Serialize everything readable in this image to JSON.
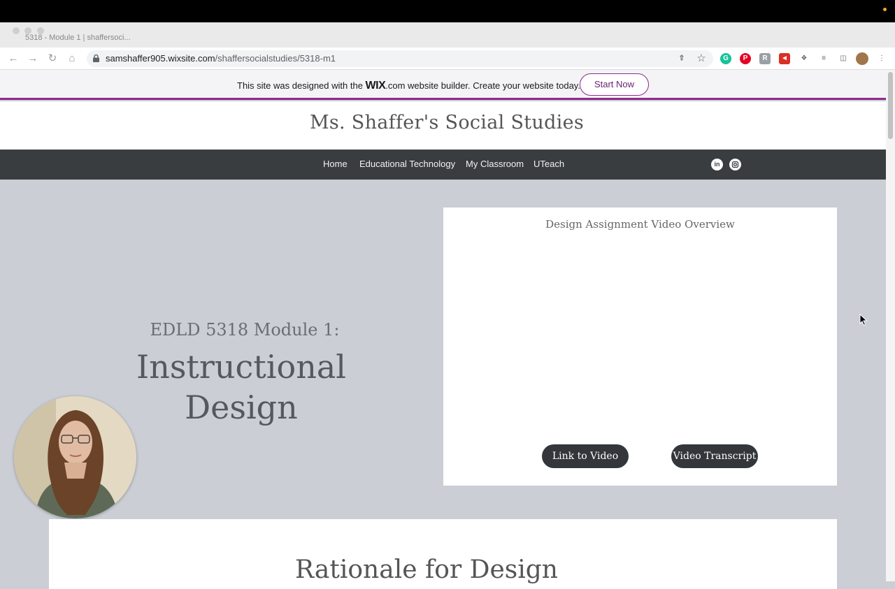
{
  "browser": {
    "tab_title": "5318 - Module 1 | shaffersoci...",
    "url_host": "samshaffer905.wixsite.com",
    "url_path": "/shaffersocialstudies/5318-m1"
  },
  "wix_banner": {
    "text_before": "This site was designed with the ",
    "brand": "WIX",
    "text_after": ".com website builder. Create your website today.",
    "cta_label": "Start Now"
  },
  "site": {
    "title": "Ms. Shaffer's Social Studies",
    "nav": [
      "Home",
      "Educational Technology",
      "My Classroom",
      "UTeach"
    ],
    "social": [
      "linkedin-icon",
      "instagram-icon"
    ]
  },
  "hero": {
    "subtitle": "EDLD 5318 Module 1:",
    "title_line1": "Instructional",
    "title_line2": "Design"
  },
  "video_card": {
    "title": "Design Assignment Video Overview",
    "link_button": "Link to Video",
    "transcript_button": "Video Transcript"
  },
  "rationale": {
    "title": "Rationale for Design"
  },
  "colors": {
    "nav_bg": "#3a3d40",
    "page_bg": "#cbced4",
    "wix_accent": "#8e2a8e"
  }
}
